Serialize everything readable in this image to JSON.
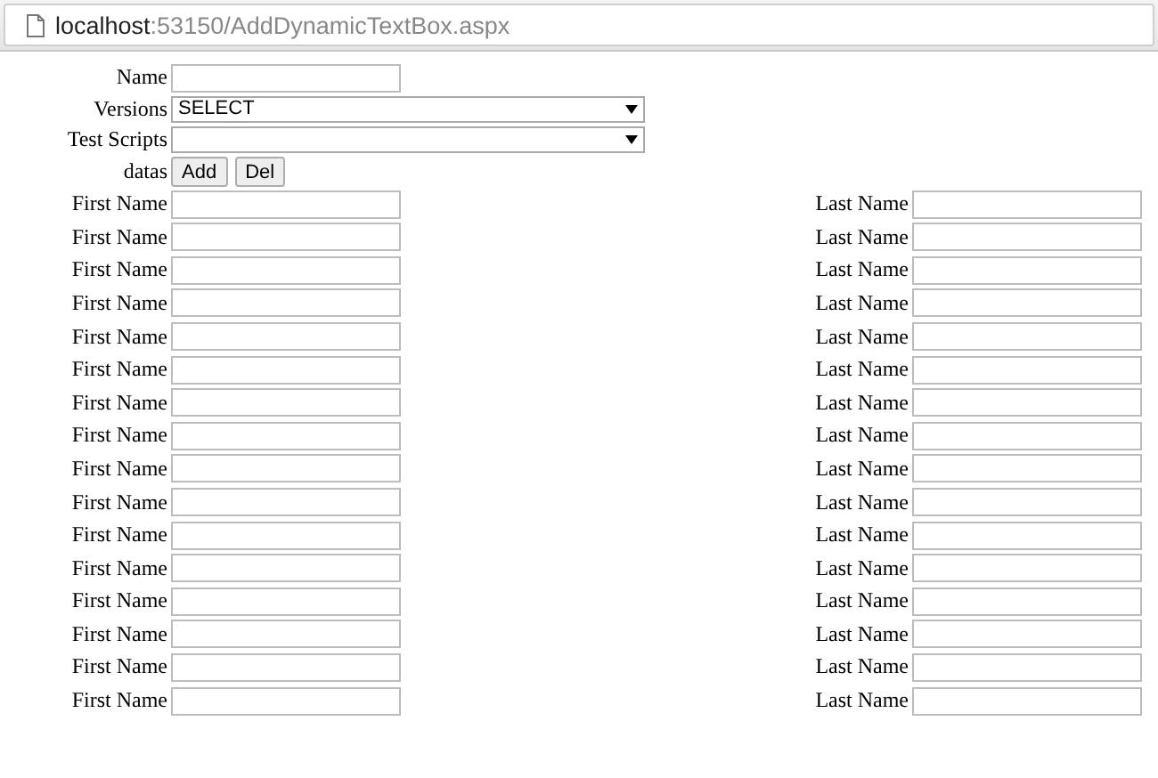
{
  "address_bar": {
    "host": "localhost",
    "path": ":53150/AddDynamicTextBox.aspx"
  },
  "form": {
    "fields": [
      {
        "kind": "text",
        "label": "Name"
      },
      {
        "kind": "select",
        "label": "Versions",
        "value": "SELECT"
      },
      {
        "kind": "select",
        "label": "Test Scripts"
      },
      {
        "kind": "buttons",
        "label": "datas",
        "buttons": [
          "Add",
          "Del"
        ]
      }
    ],
    "rows": [
      {
        "first_label": "First Name",
        "last_label": "Last Name"
      },
      {
        "first_label": "First Name",
        "last_label": "Last Name"
      },
      {
        "first_label": "First Name",
        "last_label": "Last Name"
      },
      {
        "first_label": "First Name",
        "last_label": "Last Name"
      },
      {
        "first_label": "First Name",
        "last_label": "Last Name"
      },
      {
        "first_label": "First Name",
        "last_label": "Last Name"
      },
      {
        "first_label": "First Name",
        "last_label": "Last Name"
      },
      {
        "first_label": "First Name",
        "last_label": "Last Name"
      },
      {
        "first_label": "First Name",
        "last_label": "Last Name"
      },
      {
        "first_label": "First Name",
        "last_label": "Last Name"
      },
      {
        "first_label": "First Name",
        "last_label": "Last Name"
      },
      {
        "first_label": "First Name",
        "last_label": "Last Name"
      },
      {
        "first_label": "First Name",
        "last_label": "Last Name"
      },
      {
        "first_label": "First Name",
        "last_label": "Last Name"
      },
      {
        "first_label": "First Name",
        "last_label": "Last Name"
      },
      {
        "first_label": "First Name",
        "last_label": "Last Name"
      }
    ]
  }
}
